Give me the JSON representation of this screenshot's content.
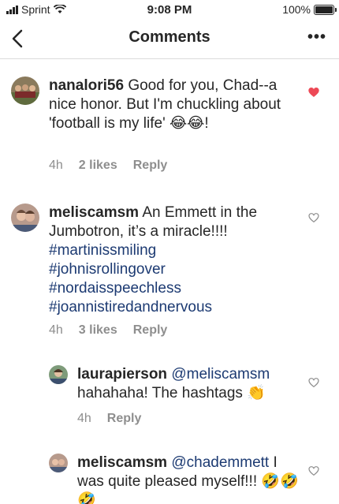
{
  "status_bar": {
    "carrier": "Sprint",
    "time": "9:08 PM",
    "battery": "100%"
  },
  "nav": {
    "title": "Comments"
  },
  "comments": [
    {
      "username": "nanalori56",
      "text": "Good for you, Chad--a nice honor. But I'm chuckling about 'football is my life'",
      "emoji": "😂😂!",
      "time": "4h",
      "likes": "2 likes",
      "reply": "Reply",
      "liked": true
    },
    {
      "username": "meliscamsm",
      "text": "An Emmett in the Jumbotron, it’s a miracle!!!!",
      "hashtags": [
        "#martinissmiling",
        "#johnisrollingover",
        "#nordaisspeechless",
        "#joannistiredandnervous"
      ],
      "time": "4h",
      "likes": "3 likes",
      "reply": "Reply",
      "liked": false
    }
  ],
  "replies": [
    {
      "username": "laurapierson",
      "mention": "@meliscamsm",
      "text": "hahahaha! The hashtags",
      "emoji": "👏",
      "time": "4h",
      "reply": "Reply",
      "liked": false
    },
    {
      "username": "meliscamsm",
      "mention": "@chademmett",
      "text": "I was quite pleased myself!!!",
      "emoji": "🤣🤣🤣",
      "liked": false
    }
  ],
  "colors": {
    "like_red": "#ed4956",
    "hashtag_blue": "#1c3a72",
    "meta_gray": "#8e8e8e"
  }
}
